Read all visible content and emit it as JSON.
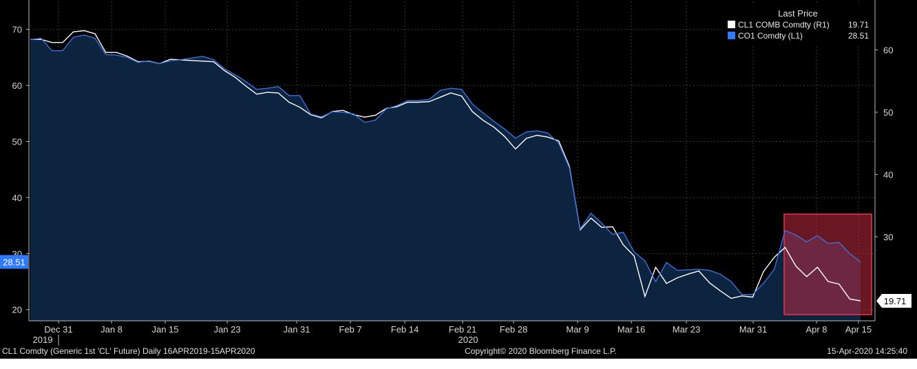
{
  "footer": {
    "left": "CL1 Comdty (Generic 1st 'CL' Future)  Daily 16APR2019-15APR2020",
    "center": "Copyright© 2020 Bloomberg Finance L.P.",
    "right": "15-Apr-2020 14:25:40"
  },
  "legend": {
    "title": "Last Price",
    "entries": [
      {
        "label": "CL1 COMB Comdty  (R1)",
        "value": "19.71",
        "color": "#ffffff"
      },
      {
        "label": "CO1 Comdty  (L1)",
        "value": "28.51",
        "color": "#2f7bff"
      }
    ]
  },
  "colors": {
    "background": "#000000",
    "area_fill": "#0d2440",
    "co1_line": "#3d6fd9",
    "cl1_line": "#ffffff",
    "highlight_fill": "#c0293f",
    "highlight_stroke": "#e8354d",
    "grid": "#3a3a3a"
  },
  "chart_data": {
    "type": "line",
    "title": "",
    "x_labels": [
      "Dec 31",
      "Jan 8",
      "Jan 15",
      "Jan 23",
      "Jan 31",
      "Feb 7",
      "Feb 14",
      "Feb 21",
      "Feb 28",
      "Mar 9",
      "Mar 16",
      "Mar 23",
      "Mar 31",
      "Apr 8",
      "Apr 15"
    ],
    "year_labels": [
      "2019",
      "2020"
    ],
    "left_axis": {
      "ticks": [
        20,
        30,
        40,
        50,
        60,
        70
      ],
      "range": [
        18,
        75
      ],
      "series": "CO1 Comdty (L1)"
    },
    "right_axis": {
      "ticks": [
        30,
        40,
        50,
        60
      ],
      "range": [
        16.5,
        67.8
      ],
      "series": "CL1 COMB Comdty (R1)"
    },
    "last_value_tags": {
      "left": "28.51",
      "right": "19.71"
    },
    "highlight": "Apr 2 - Apr 15",
    "series": [
      {
        "name": "CO1 Comdty (L1)",
        "axis": "left",
        "values": [
          68.2,
          68.4,
          66.2,
          66.2,
          68.6,
          69.0,
          68.4,
          65.5,
          65.4,
          65.0,
          64.1,
          64.4,
          63.9,
          64.4,
          64.6,
          64.9,
          65.2,
          64.6,
          63.0,
          61.9,
          60.7,
          59.3,
          59.5,
          59.8,
          58.2,
          58.2,
          54.9,
          54.4,
          55.3,
          55.2,
          54.9,
          53.4,
          53.8,
          55.8,
          56.4,
          57.3,
          57.3,
          57.5,
          59.1,
          59.5,
          59.3,
          56.7,
          55.1,
          53.6,
          52.2,
          50.6,
          51.7,
          51.9,
          51.5,
          49.7,
          45.3,
          34.4,
          37.2,
          35.4,
          33.4,
          33.8,
          30.3,
          28.7,
          25.0,
          28.4,
          27.0,
          27.1,
          27.2,
          27.0,
          26.3,
          25.0,
          22.7,
          22.7,
          24.7,
          27.2,
          34.1,
          33.3,
          32.1,
          33.2,
          31.8,
          32.0,
          30.0,
          28.51
        ]
      },
      {
        "name": "CL1 COMB Comdty (R1)",
        "axis": "right",
        "values": [
          61.7,
          61.7,
          61.2,
          61.2,
          62.9,
          63.1,
          62.6,
          59.6,
          59.6,
          59.0,
          58.1,
          58.2,
          57.8,
          58.5,
          58.4,
          58.3,
          58.2,
          58.1,
          56.7,
          55.6,
          54.2,
          52.9,
          53.2,
          53.1,
          51.6,
          50.8,
          49.6,
          49.1,
          50.1,
          50.3,
          49.6,
          49.2,
          49.5,
          50.6,
          50.9,
          51.6,
          51.6,
          51.7,
          52.4,
          53.1,
          52.6,
          50.1,
          48.7,
          47.6,
          46.1,
          44.1,
          45.8,
          46.3,
          46.0,
          45.4,
          41.3,
          31.1,
          33.0,
          31.5,
          31.6,
          28.7,
          26.9,
          20.4,
          25.1,
          22.5,
          23.4,
          24.0,
          24.5,
          22.6,
          21.3,
          20.1,
          20.5,
          20.3,
          24.4,
          26.7,
          28.3,
          25.3,
          23.6,
          25.1,
          22.8,
          22.4,
          20.0,
          19.71
        ]
      }
    ]
  }
}
